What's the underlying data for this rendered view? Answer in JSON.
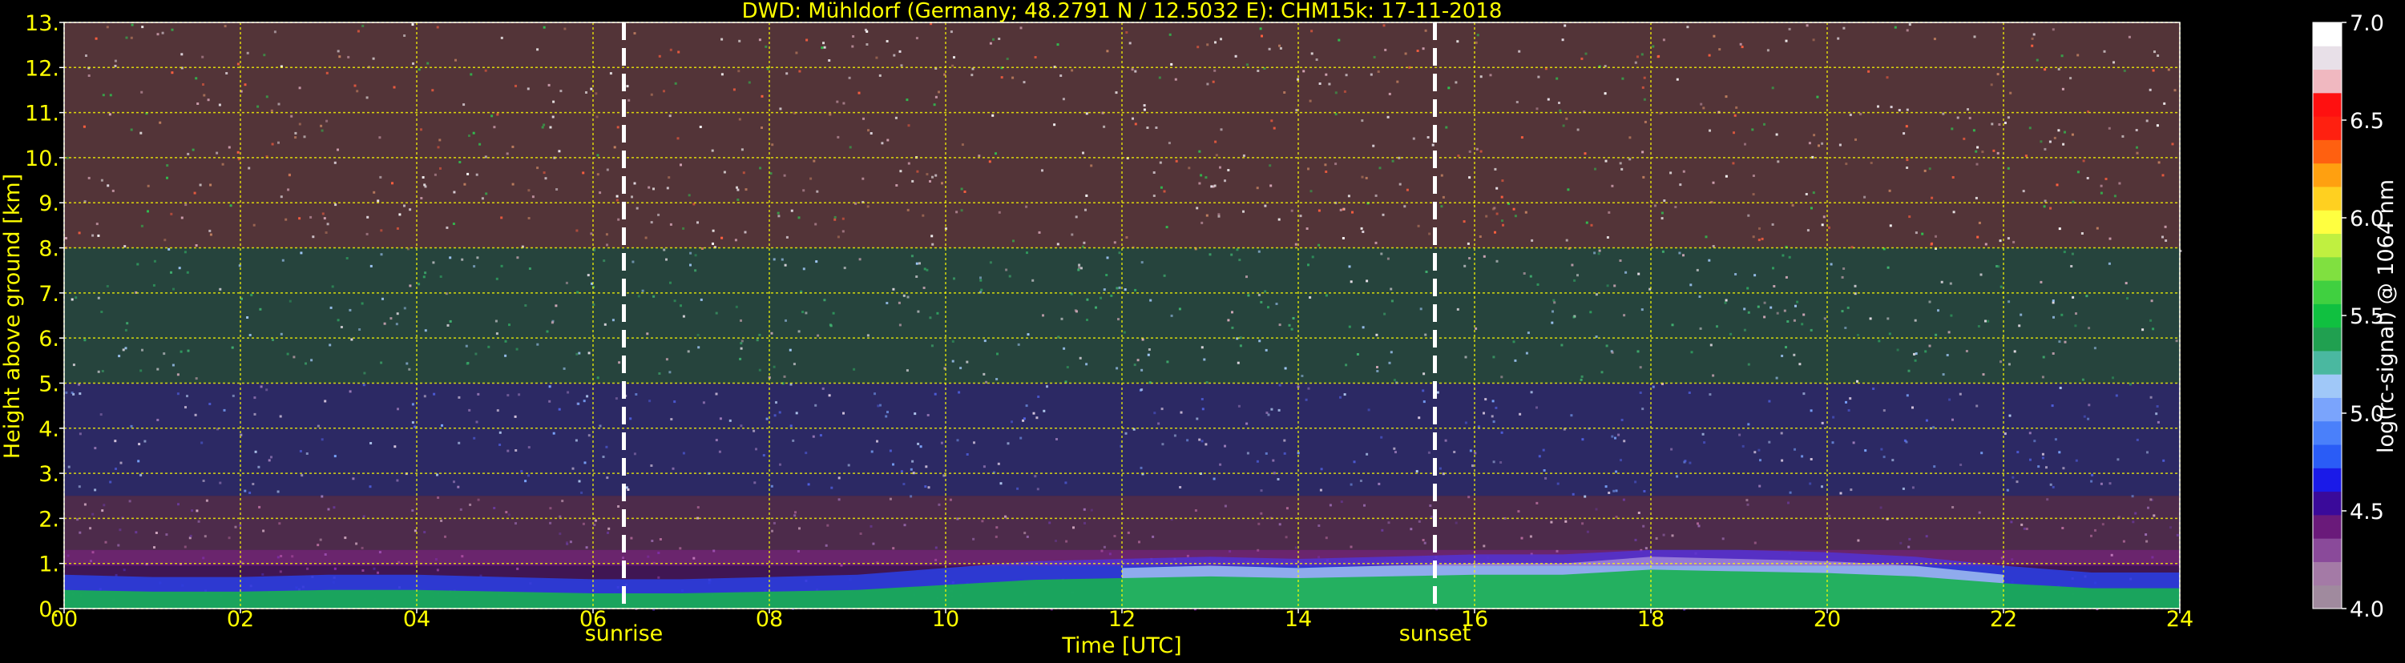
{
  "chart_data": {
    "type": "heatmap",
    "title": "DWD: Mühldorf (Germany; 48.2791 N / 12.5032 E):    CHM15k: 17-11-2018",
    "xlabel": "Time [UTC]",
    "ylabel": "Height above ground [km]",
    "colorbar_label": "log(rc-signal) @ 1064 nm",
    "xlim": [
      0,
      24
    ],
    "ylim": [
      0,
      13
    ],
    "clim": [
      4.0,
      7.0
    ],
    "grid": true,
    "x_tick_labels": [
      "00",
      "02",
      "04",
      "06",
      "08",
      "10",
      "12",
      "14",
      "16",
      "18",
      "20",
      "22",
      "24"
    ],
    "y_tick_labels": [
      "0.",
      "1.",
      "2.",
      "3.",
      "4.",
      "5.",
      "6.",
      "7.",
      "8.",
      "9.",
      "10.",
      "11.",
      "12.",
      "13."
    ],
    "colorbar_ticks": [
      "4.0",
      "4.5",
      "5.0",
      "5.5",
      "6.0",
      "6.5",
      "7.0"
    ],
    "colorbar_colors": [
      "#a08a9e",
      "#a47aa6",
      "#8a4a9a",
      "#6a1a7a",
      "#3a0a9a",
      "#1a1ae8",
      "#2a5cf6",
      "#4a80fa",
      "#7aa4fc",
      "#a0c8f8",
      "#4ab8a0",
      "#20a050",
      "#10c040",
      "#40d040",
      "#80e040",
      "#c0f040",
      "#ffff40",
      "#ffd020",
      "#ffa010",
      "#ff6010",
      "#ff2010",
      "#ff1010",
      "#f0b8c0",
      "#e8e0e8",
      "#ffffff"
    ],
    "annotations": [
      {
        "label": "sunrise",
        "x": 6.35
      },
      {
        "label": "sunset",
        "x": 15.55
      }
    ],
    "boundary_layer_top_km": [
      [
        0,
        0.55
      ],
      [
        1,
        0.5
      ],
      [
        2,
        0.5
      ],
      [
        3,
        0.55
      ],
      [
        4,
        0.55
      ],
      [
        5,
        0.5
      ],
      [
        6,
        0.45
      ],
      [
        7,
        0.45
      ],
      [
        8,
        0.5
      ],
      [
        9,
        0.55
      ],
      [
        10,
        0.7
      ],
      [
        11,
        0.85
      ],
      [
        12,
        0.9
      ],
      [
        13,
        0.95
      ],
      [
        14,
        0.9
      ],
      [
        15,
        0.95
      ],
      [
        16,
        1.0
      ],
      [
        17,
        1.0
      ],
      [
        18,
        1.15
      ],
      [
        19,
        1.1
      ],
      [
        20,
        1.05
      ],
      [
        21,
        0.95
      ],
      [
        22,
        0.75
      ],
      [
        23,
        0.6
      ],
      [
        24,
        0.6
      ]
    ],
    "noise_layers": [
      {
        "from_km": 0.0,
        "to_km": 1.0,
        "colors": [
          "#8a2cb0",
          "#4a2a9c",
          "#a04aa8"
        ]
      },
      {
        "from_km": 1.0,
        "to_km": 2.5,
        "colors": [
          "#b06898",
          "#6a3a9a",
          "#9a6ab0",
          "#d0a8c0"
        ]
      },
      {
        "from_km": 2.5,
        "to_km": 5.0,
        "colors": [
          "#5060e0",
          "#7aa4fc",
          "#9a7ab8",
          "#b0c8f0",
          "#d8c8e0"
        ]
      },
      {
        "from_km": 5.0,
        "to_km": 8.0,
        "colors": [
          "#40b070",
          "#a0c8f8",
          "#d0a8b8",
          "#30a060",
          "#e8e0e8"
        ]
      },
      {
        "from_km": 8.0,
        "to_km": 13.0,
        "colors": [
          "#c08060",
          "#e8e0e8",
          "#30c050",
          "#ff6040",
          "#d0a0b0",
          "#ffffff"
        ]
      }
    ]
  }
}
